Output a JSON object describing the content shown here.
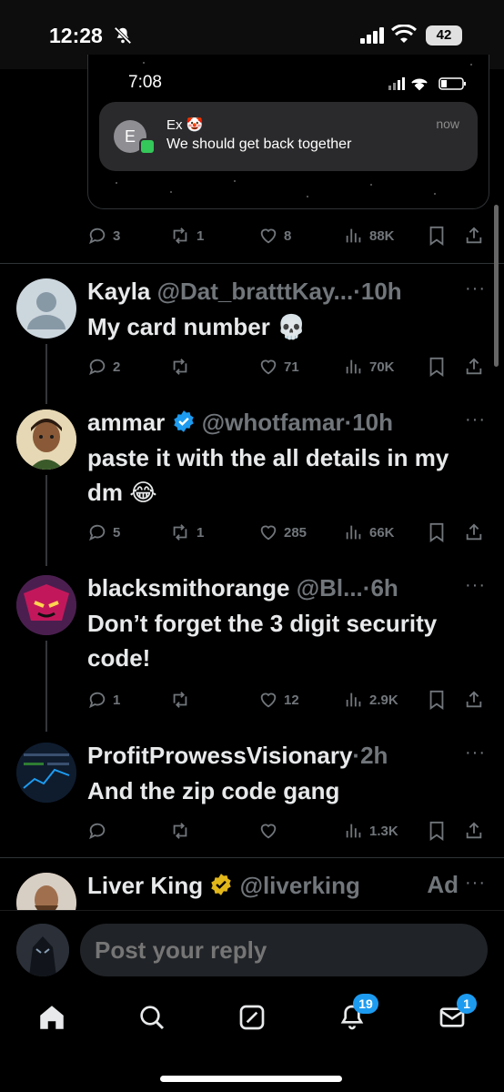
{
  "status_bar": {
    "time": "12:28",
    "battery": "42"
  },
  "embedded_screenshot": {
    "time": "7:08",
    "notification": {
      "avatar_letter": "E",
      "sender": "Ex 🤡",
      "message": "We should get back together",
      "time": "now"
    }
  },
  "top_actions": {
    "replies": "3",
    "reposts": "1",
    "likes": "8",
    "views": "88K"
  },
  "tweets": [
    {
      "name": "Kayla",
      "handle": "@Dat_bratttKay...",
      "time": "·10h",
      "text": "My card number 💀",
      "replies": "2",
      "reposts": "",
      "likes": "71",
      "views": "70K"
    },
    {
      "name": "ammar",
      "handle": "@whotfamar",
      "time": "·10h",
      "text": "paste it with the all details in my dm 😂",
      "replies": "5",
      "reposts": "1",
      "likes": "285",
      "views": "66K"
    },
    {
      "name": "blacksmithorange",
      "handle": "@Bl...",
      "time": "·6h",
      "text": "Don’t forget the 3 digit security code!",
      "replies": "1",
      "reposts": "",
      "likes": "12",
      "views": "2.9K"
    },
    {
      "name": "ProfitProwessVisionary",
      "handle": "",
      "time": "·2h",
      "text": "And the zip code gang",
      "replies": "",
      "reposts": "",
      "likes": "",
      "views": "1.3K"
    },
    {
      "name": "Liver King",
      "handle": "@liverking",
      "time": "Ad",
      "text": ""
    }
  ],
  "reply_bar": {
    "placeholder": "Post your reply"
  },
  "nav": {
    "notifications_badge": "19",
    "messages_badge": "1"
  },
  "colors": {
    "accent": "#1d9bf0",
    "gold": "#e2b719",
    "muted": "#71767b"
  }
}
